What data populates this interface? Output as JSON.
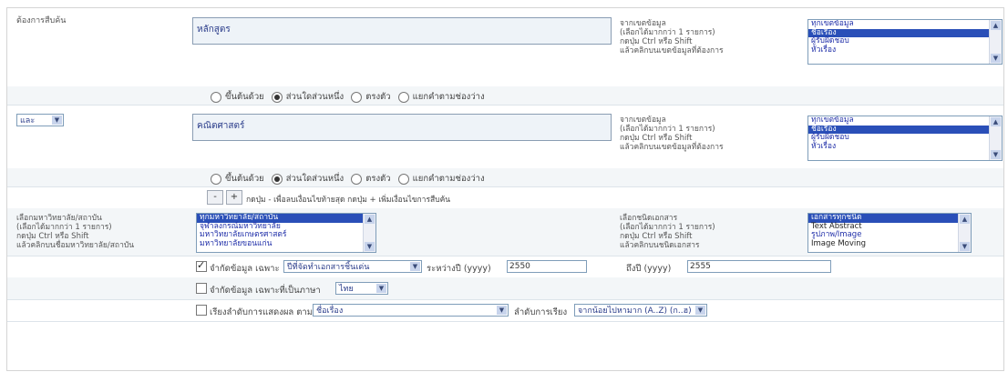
{
  "field1": {
    "label": "ต้องการสืบค้น",
    "value": "หลักสูตร"
  },
  "field2": {
    "operator": "และ",
    "value": "คณิตศาสตร์"
  },
  "field_hint": [
    "จากเขตข้อมูล",
    "(เลือกได้มากกว่า 1 รายการ)",
    "กดปุ่ม Ctrl หรือ Shift",
    "แล้วคลิกบนเขตข้อมูลที่ต้องการ"
  ],
  "field_options": [
    "ทุกเขตข้อมูล",
    "ชื่อเรื่อง",
    "ผู้รับผิดชอบ",
    "หัวเรื่อง"
  ],
  "match_options": [
    "ขึ้นต้นด้วย",
    "ส่วนใดส่วนหนึ่ง",
    "ตรงตัว",
    "แยกคำตามช่องว่าง"
  ],
  "add_remove": {
    "minus": "-",
    "plus": "+",
    "text": "กดปุ่ม - เพื่อลบเงื่อนไขท้ายสุด กดปุ่ม + เพิ่มเงื่อนไขการสืบค้น"
  },
  "university": {
    "hint": [
      "เลือกมหาวิทยาลัย/สถาบัน",
      "(เลือกได้มากกว่า 1 รายการ)",
      "กดปุ่ม Ctrl หรือ Shift",
      "แล้วคลิกบนชื่อมหาวิทยาลัย/สถาบัน"
    ],
    "options": [
      "ทุกมหาวิทยาลัย/สถาบัน",
      "จุฬาลงกรณ์มหาวิทยาลัย",
      "มหาวิทยาลัยเกษตรศาสตร์",
      "มหาวิทยาลัยขอนแก่น"
    ]
  },
  "doctype": {
    "hint": [
      "เลือกชนิดเอกสาร",
      "(เลือกได้มากกว่า 1 รายการ)",
      "กดปุ่ม Ctrl หรือ Shift",
      "แล้วคลิกบนชนิดเอกสาร"
    ],
    "options": [
      "เอกสารทุกชนิด",
      "Text Abstract",
      "รูปภาพ/Image",
      "Image Moving"
    ]
  },
  "limit_year": {
    "label": "จำกัดข้อมูล เฉพาะ",
    "select": "ปีที่จัดทำเอกสารชิ้นเด่น",
    "from_label": "ระหว่างปี (yyyy)",
    "from": "2550",
    "to_label": "ถึงปี (yyyy)",
    "to": "2555"
  },
  "limit_lang": {
    "label": "จำกัดข้อมูล เฉพาะที่เป็นภาษา",
    "select": "ไทย"
  },
  "sort": {
    "label": "เรียงลำดับการแสดงผล ตาม",
    "select": "ชื่อเรื่อง",
    "order_label": "ลำดับการเรียง",
    "order": "จากน้อยไปหามาก (A..Z) (ก..ฮ)"
  }
}
